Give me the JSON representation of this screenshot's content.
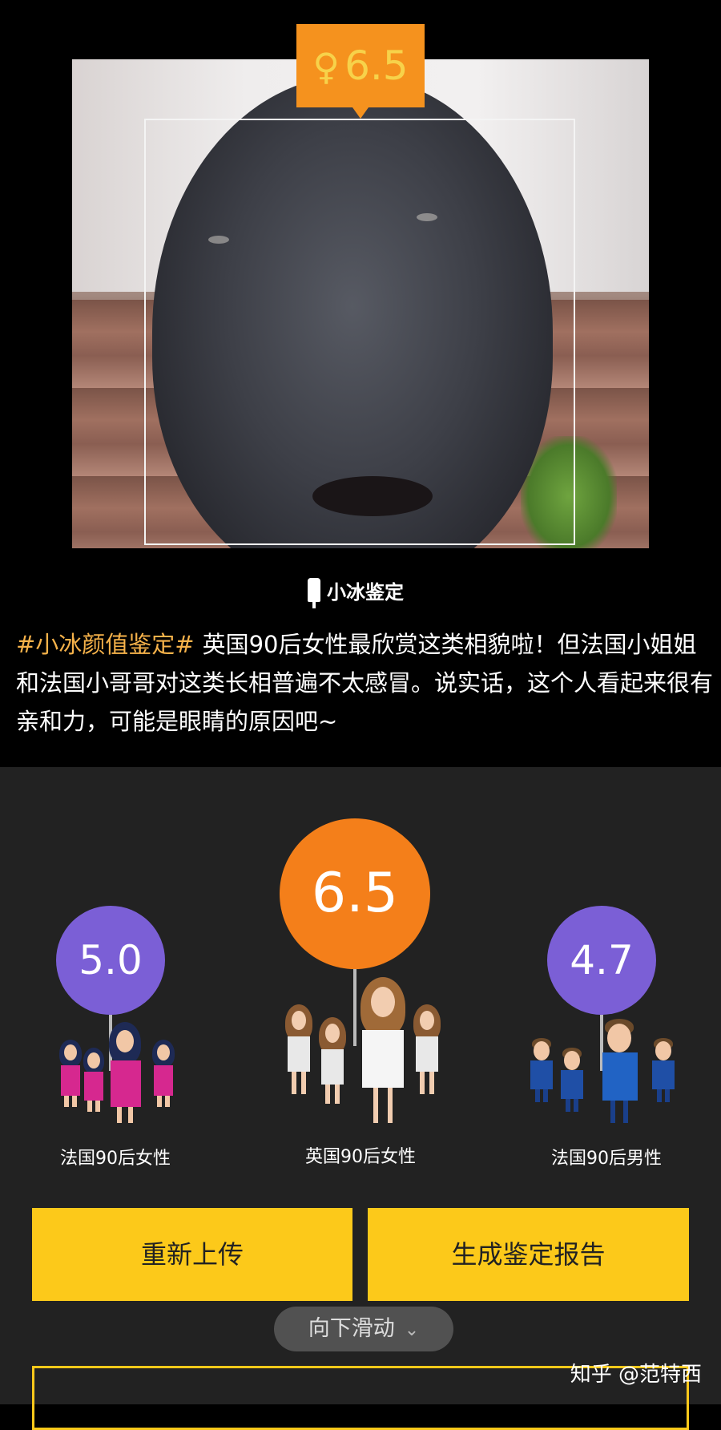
{
  "photo_score": {
    "symbol": "♀",
    "value": "6.5"
  },
  "brand": {
    "name": "小冰鉴定"
  },
  "description": {
    "hashtag": "#小冰颜值鉴定#",
    "text": "英国90后女性最欣赏这类相貌啦！但法国小姐姐和法国小哥哥对这类长相普遍不太感冒。说实话，这个人看起来很有亲和力，可能是眼睛的原因吧~"
  },
  "ratings": [
    {
      "score": "5.0",
      "label": "法国90后女性",
      "color": "#7b5fd6"
    },
    {
      "score": "6.5",
      "label": "英国90后女性",
      "color": "#f47f1a"
    },
    {
      "score": "4.7",
      "label": "法国90后男性",
      "color": "#7b5fd6"
    }
  ],
  "buttons": {
    "reupload": "重新上传",
    "report": "生成鉴定报告"
  },
  "scroll_hint": "向下滑动",
  "watermark": "知乎 @范特西",
  "icons": {
    "gender": "female-symbol",
    "scroll": "chevron-down-icon",
    "brand": "ice-popsicle-logo"
  },
  "colors": {
    "accent_orange": "#f5921e",
    "purple": "#7b5fd6",
    "button_yellow": "#fcc91a",
    "hashtag": "#f6b24a"
  }
}
